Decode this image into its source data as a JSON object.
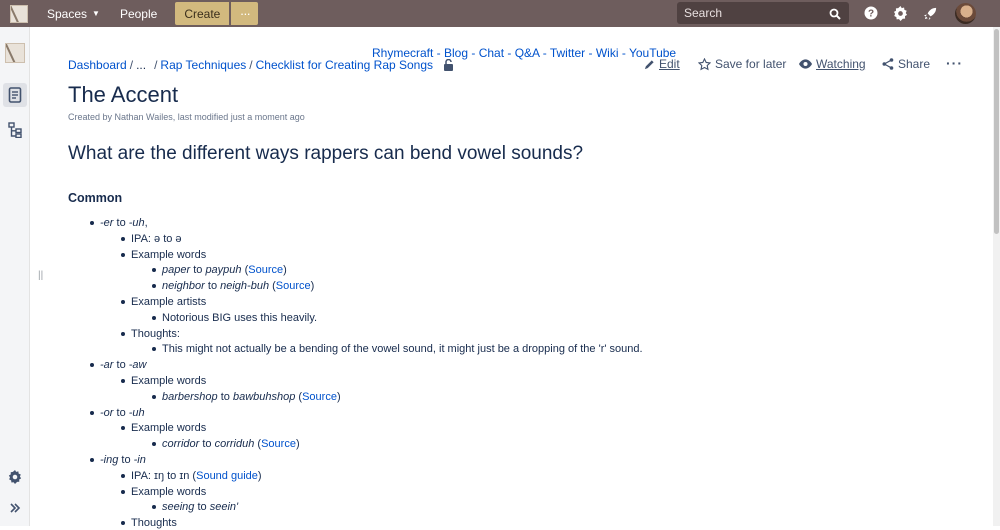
{
  "topbar": {
    "spaces_label": "Spaces",
    "people_label": "People",
    "create_label": "Create",
    "more_label": "···",
    "search_placeholder": "Search"
  },
  "header": {
    "top_links": "Rhymecraft - Blog - Chat - Q&A - Twitter - Wiki - YouTube",
    "breadcrumb": [
      "Dashboard",
      "...",
      "Rap Techniques",
      "Checklist for Creating Rap Songs"
    ],
    "actions": {
      "edit": "Edit",
      "save_for_later": "Save for later",
      "watching": "Watching",
      "share": "Share"
    }
  },
  "page": {
    "title": "The Accent",
    "byline": "Created by Nathan Wailes, last modified just a moment ago",
    "subtitle": "What are the different ways rappers can bend vowel sounds?",
    "section": "Common"
  },
  "list": [
    {
      "level": 1,
      "parts": [
        {
          "t": "-er",
          "i": true
        },
        {
          "t": " to "
        },
        {
          "t": "-uh",
          "i": true
        },
        {
          "t": ","
        }
      ]
    },
    {
      "level": 2,
      "parts": [
        {
          "t": "IPA: ə to ə"
        }
      ]
    },
    {
      "level": 2,
      "parts": [
        {
          "t": "Example words"
        }
      ]
    },
    {
      "level": 3,
      "parts": [
        {
          "t": "paper",
          "i": true
        },
        {
          "t": " to "
        },
        {
          "t": "paypuh",
          "i": true
        },
        {
          "t": " ("
        },
        {
          "t": "Source",
          "l": true
        },
        {
          "t": ")"
        }
      ]
    },
    {
      "level": 3,
      "parts": [
        {
          "t": "neighbor",
          "i": true
        },
        {
          "t": " to "
        },
        {
          "t": "neigh-buh",
          "i": true
        },
        {
          "t": " ("
        },
        {
          "t": "Source",
          "l": true
        },
        {
          "t": ")"
        }
      ]
    },
    {
      "level": 2,
      "parts": [
        {
          "t": "Example artists"
        }
      ]
    },
    {
      "level": 3,
      "parts": [
        {
          "t": "Notorious BIG uses this heavily."
        }
      ]
    },
    {
      "level": 2,
      "parts": [
        {
          "t": "Thoughts:"
        }
      ]
    },
    {
      "level": 3,
      "parts": [
        {
          "t": "This might not actually be a bending of the vowel sound, it might just be a dropping of the 'r' sound."
        }
      ]
    },
    {
      "level": 1,
      "parts": [
        {
          "t": "-ar",
          "i": true
        },
        {
          "t": " to "
        },
        {
          "t": "-aw",
          "i": true
        }
      ]
    },
    {
      "level": 2,
      "parts": [
        {
          "t": "Example words"
        }
      ]
    },
    {
      "level": 3,
      "parts": [
        {
          "t": "barbershop",
          "i": true
        },
        {
          "t": " to "
        },
        {
          "t": "bawbuhshop",
          "i": true
        },
        {
          "t": " ("
        },
        {
          "t": "Source",
          "l": true
        },
        {
          "t": ")"
        }
      ]
    },
    {
      "level": 1,
      "parts": [
        {
          "t": "-or",
          "i": true
        },
        {
          "t": " to "
        },
        {
          "t": "-uh",
          "i": true
        }
      ]
    },
    {
      "level": 2,
      "parts": [
        {
          "t": "Example words"
        }
      ]
    },
    {
      "level": 3,
      "parts": [
        {
          "t": "corridor",
          "i": true
        },
        {
          "t": " to "
        },
        {
          "t": "corriduh",
          "i": true
        },
        {
          "t": " ("
        },
        {
          "t": "Source",
          "l": true
        },
        {
          "t": ")"
        }
      ]
    },
    {
      "level": 1,
      "parts": [
        {
          "t": "-ing",
          "i": true
        },
        {
          "t": " to "
        },
        {
          "t": "-in",
          "i": true
        }
      ]
    },
    {
      "level": 2,
      "parts": [
        {
          "t": "IPA: ɪŋ to ɪn ("
        },
        {
          "t": "Sound guide",
          "l": true
        },
        {
          "t": ")"
        }
      ]
    },
    {
      "level": 2,
      "parts": [
        {
          "t": "Example words"
        }
      ]
    },
    {
      "level": 3,
      "parts": [
        {
          "t": "seeing",
          "i": true
        },
        {
          "t": " to "
        },
        {
          "t": "seein'",
          "i": true
        }
      ]
    },
    {
      "level": 2,
      "parts": [
        {
          "t": "Thoughts"
        }
      ]
    }
  ],
  "icons": {
    "search": "search-icon",
    "help": "help-icon",
    "settings": "gear-icon",
    "notifications": "rocket-icon",
    "edit": "pencil-icon",
    "save": "star-icon",
    "watch": "eye-icon",
    "share": "share-icon",
    "more": "more-icon",
    "restriction": "unlock-icon"
  },
  "colors": {
    "topbar": "#6e5d5d",
    "create_button": "#d2b97e",
    "link": "#0052cc",
    "text": "#172b4d"
  }
}
